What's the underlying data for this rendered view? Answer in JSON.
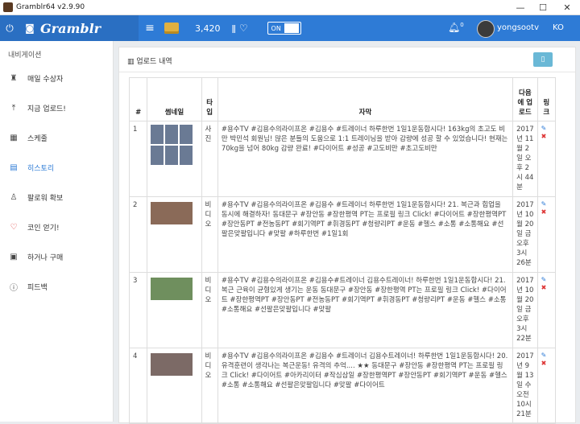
{
  "window": {
    "title": "Gramblr64 v2.9.90",
    "min": "—",
    "max": "☐",
    "close": "✕"
  },
  "topbar": {
    "brand": "Gramblr",
    "coins": "3,420",
    "toggle_on": "ON",
    "notif_count": "0",
    "username": "yongsootv",
    "lang": "KO"
  },
  "sidebar": {
    "header": "내비게이션",
    "items": [
      {
        "label": "매일 수상자",
        "icon": "trophy-icon"
      },
      {
        "label": "지금 업로드!",
        "icon": "upload-icon"
      },
      {
        "label": "스케줄",
        "icon": "calendar-icon"
      },
      {
        "label": "히스토리",
        "icon": "book-icon"
      },
      {
        "label": "팔로워 확보",
        "icon": "user-icon"
      },
      {
        "label": "코인 얻기!",
        "icon": "heart-icon"
      },
      {
        "label": "하거나 구매",
        "icon": "wallet-icon"
      },
      {
        "label": "피드백",
        "icon": "question-icon"
      }
    ]
  },
  "panel": {
    "title": "업로드 내역",
    "export_icon": "clipboard-icon"
  },
  "table": {
    "headers": {
      "num": "#",
      "thumb": "썸네일",
      "type": "타입",
      "caption": "자막",
      "next": "다음에 업로드",
      "link": "링크"
    },
    "rows": [
      {
        "num": "1",
        "type": "사진",
        "caption": "#용수TV #김용수의라이프온 #김용수 #트레이너 하루한번 1일1운동합시다! 163kg의 초고도 비만 박민석 회원님! 많은 분들의 도움으로 1:1 트레이닝을 받아 감량에 성공 할 수 있었습니다! 현재는 70kg을 넘어 80kg 감량 완료! #다이어트 #성공 #고도비만 #초고도비만",
        "next": "2017년 11월 2일 오후 2시 44분"
      },
      {
        "num": "2",
        "type": "비디오",
        "caption": "#용수TV #김용수의라이프온 #김용수 #트레이너 하루한번 1일1운동합시다! 21. 복근과 힙업을 동시에 해결하자! 동대문구 #장안동 #장한평역 PT는 프로필 링크 Click! #다이어트 #장한평역PT #장안동PT #전농동PT #회기역PT #휘경동PT #청량리PT #운동 #헬스 #소통 #소통해요 #선팔은맞팔입니다 #맞팔 #하루한번 #1일1회",
        "next": "2017년 10월 20일 금 오후 3시 26분"
      },
      {
        "num": "3",
        "type": "비디오",
        "caption": "#용수TV #김용수의라이프온 #김용수#트레이너 김용수트레이너! 하루한번 1일1운동합시다! 21. 복근 근육이 균형있게 생기는 운동 동대문구 #장안동 #장한평역 PT는 프로필 링크 Click! #다이어트 #장한평역PT #장안동PT #전농동PT #회기역PT #휘경동PT #청량리PT #운동 #헬스 #소통 #소통해요 #선팔은맞팔입니다 #맞팔",
        "next": "2017년 10월 20일 금 오후 3시 22분"
      },
      {
        "num": "4",
        "type": "비디오",
        "caption": "#용수TV #김용수의라이프온 #김용수 #트레이너 김용수트레이너! 하루한번 1일1운동합시다! 20. 유격훈련이 생각나는 복근운동! 유격의 추억.... ★★ 동대문구 #장안동 #장한평역 PT는 프로필 링크 Click! #다이어트 #아카리이터 #작심삼일 #장한평역PT #장안동PT #회기역PT #운동 #헬스 #소통 #소통해요 #선팔은맞팔입니다 #맞팔 #다이어트",
        "next": "2017년 9월 13일 수 오전 10시 21분"
      }
    ]
  },
  "colors": {
    "accent": "#2e7bd6",
    "danger": "#d33333",
    "info": "#6ab8d6"
  }
}
